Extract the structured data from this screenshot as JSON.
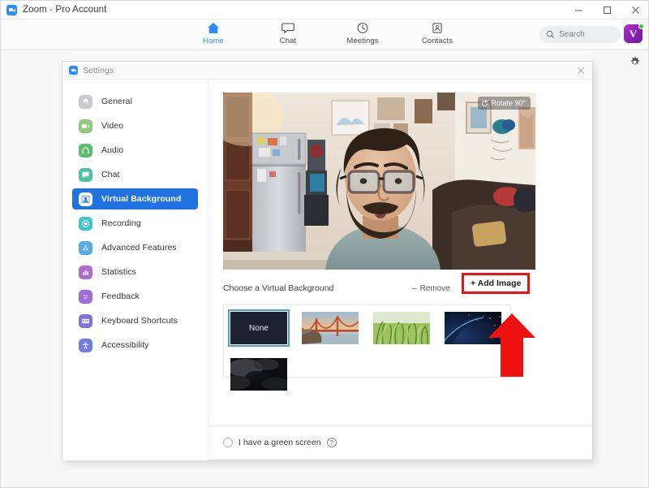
{
  "window": {
    "title": "Zoom - Pro Account",
    "app_icon": "zoom-video-icon",
    "controls": {
      "minimize": "–",
      "maximize": "□",
      "close": "×"
    }
  },
  "navbar": {
    "tabs": [
      {
        "label": "Home",
        "icon": "home-icon",
        "active": true
      },
      {
        "label": "Chat",
        "icon": "chat-bubble-icon",
        "active": false
      },
      {
        "label": "Meetings",
        "icon": "clock-icon",
        "active": false
      },
      {
        "label": "Contacts",
        "icon": "contact-card-icon",
        "active": false
      }
    ],
    "search": {
      "placeholder": "Search",
      "icon": "search-icon"
    },
    "avatar": {
      "initial": "V",
      "status": "online",
      "status_color": "#3ec73e"
    },
    "gear": {
      "icon": "gear-icon"
    }
  },
  "settings_dialog": {
    "title": "Settings",
    "close_label": "×",
    "sidebar": [
      {
        "label": "General",
        "icon": "gear-icon",
        "color": "#c9c9cf",
        "active": false
      },
      {
        "label": "Video",
        "icon": "camera-icon",
        "color": "#8dc97e",
        "active": false
      },
      {
        "label": "Audio",
        "icon": "headphones-icon",
        "color": "#5bbf6f",
        "active": false
      },
      {
        "label": "Chat",
        "icon": "chat-bubble-icon",
        "color": "#4dc3a4",
        "active": false
      },
      {
        "label": "Virtual Background",
        "icon": "person-frame-icon",
        "color": "#2d8cff",
        "active": true
      },
      {
        "label": "Recording",
        "icon": "record-circle-icon",
        "color": "#3fc2d6",
        "active": false
      },
      {
        "label": "Advanced Features",
        "icon": "sparkle-icon",
        "color": "#57a9e8",
        "active": false
      },
      {
        "label": "Statistics",
        "icon": "bar-chart-icon",
        "color": "#b06bd0",
        "active": false
      },
      {
        "label": "Feedback",
        "icon": "smiley-icon",
        "color": "#9b6fd6",
        "active": false
      },
      {
        "label": "Keyboard Shortcuts",
        "icon": "keyboard-icon",
        "color": "#7f72d8",
        "active": false
      },
      {
        "label": "Accessibility",
        "icon": "accessibility-icon",
        "color": "#6f7ee0",
        "active": false
      }
    ],
    "video_preview": {
      "rotate_button": "Rotate 90°",
      "rotate_icon": "rotate-icon"
    },
    "choose_section": {
      "heading": "Choose a Virtual Background",
      "remove_label": "Remove",
      "remove_prefix": "–",
      "add_image_label": "+ Add Image",
      "highlight_color": "#ee1111"
    },
    "backgrounds": [
      {
        "name": "None",
        "type": "none",
        "selected": true
      },
      {
        "name": "Golden Gate Bridge",
        "type": "image",
        "selected": false
      },
      {
        "name": "Green Grass",
        "type": "image",
        "selected": false
      },
      {
        "name": "Earth from Space",
        "type": "image",
        "selected": false
      },
      {
        "name": "Dark Smoke",
        "type": "image",
        "selected": false
      }
    ],
    "green_screen": {
      "label": "I have a green screen",
      "checked": false,
      "help_icon": "question-mark-icon",
      "help_glyph": "?"
    },
    "annotation": {
      "arrow": "red-up-arrow",
      "arrow_color": "#ee1111"
    }
  }
}
